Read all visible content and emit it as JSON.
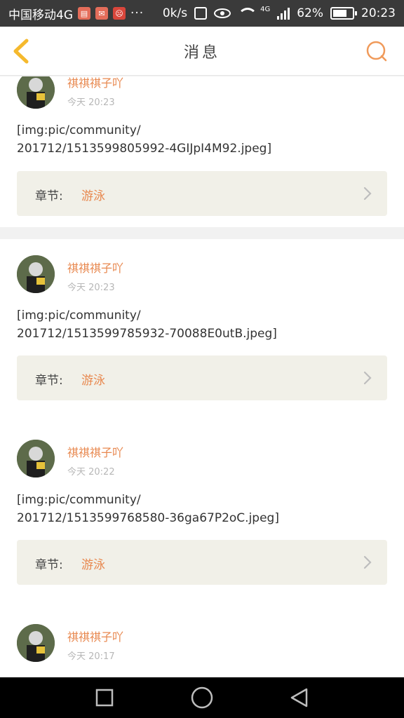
{
  "status_bar": {
    "carrier": "中国移动4G",
    "dots": "···",
    "speed": "0k/s",
    "network": "4G",
    "battery": "62%",
    "clock": "20:23"
  },
  "header": {
    "title": "消息"
  },
  "posts": [
    {
      "username": "祺祺祺子吖",
      "time": "今天 20:23",
      "content_line1": "[img:pic/community/",
      "content_line2": "201712/1513599805992-4GIJpI4M92.jpeg]",
      "chapter_label": "章节:",
      "chapter_value": "游泳"
    },
    {
      "username": "祺祺祺子吖",
      "time": "今天 20:23",
      "content_line1": "[img:pic/community/",
      "content_line2": "201712/1513599785932-70088E0utB.jpeg]",
      "chapter_label": "章节:",
      "chapter_value": "游泳"
    },
    {
      "username": "祺祺祺子吖",
      "time": "今天 20:22",
      "content_line1": "[img:pic/community/",
      "content_line2": "201712/1513599768580-36ga67P2oC.jpeg]",
      "chapter_label": "章节:",
      "chapter_value": "游泳"
    },
    {
      "username": "祺祺祺子吖",
      "time": "今天 20:17"
    }
  ],
  "colors": {
    "accent": "#e8884f",
    "back_icon": "#f5b92d",
    "search_icon": "#f09a5a"
  },
  "icons": {
    "back": "chevron-left-icon",
    "search": "search-icon",
    "chapter_arrow": "chevron-right-icon",
    "nav_recent": "square-icon",
    "nav_home": "circle-icon",
    "nav_back": "triangle-back-icon"
  }
}
